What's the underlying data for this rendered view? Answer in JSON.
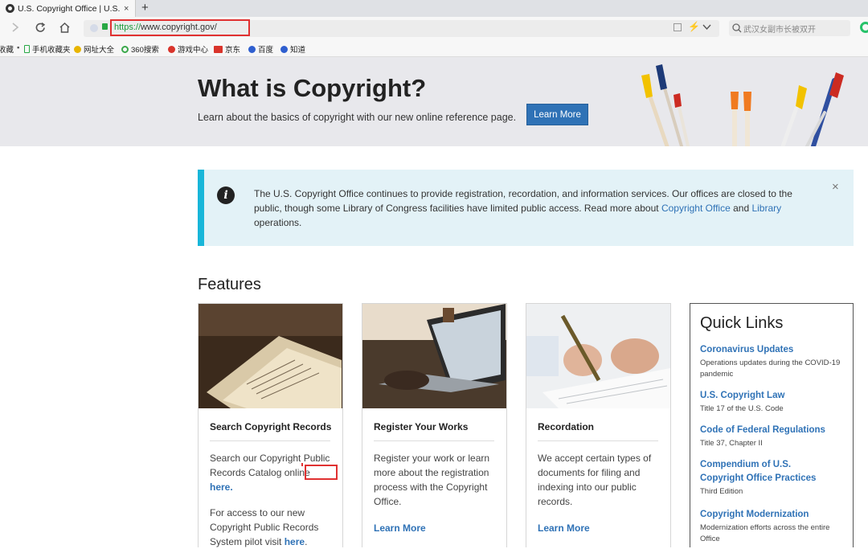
{
  "browser": {
    "tab_title": "U.S. Copyright Office | U.S. C",
    "tab_close": "×",
    "new_tab": "+",
    "url_scheme": "https://",
    "url_host": "www.copyright.gov/",
    "search_placeholder": "武汉女副市长被双开",
    "bookmarks": [
      "收藏",
      "手机收藏夹",
      "网址大全",
      "360搜索",
      "游戏中心",
      "京东",
      "百度",
      "知道"
    ]
  },
  "hero": {
    "title": "What is Copyright?",
    "subtitle": "Learn about the basics of copyright with our new online reference page.",
    "button": "Learn More"
  },
  "alert": {
    "text_before": "The U.S. Copyright Office continues to provide registration, recordation, and information services. Our offices are closed to the public, though some Library of Congress facilities have limited public access. Read more about ",
    "link1": "Copyright Office",
    "and": " and ",
    "link2": "Library",
    "text_after": " operations.",
    "close": "×",
    "icon": "i"
  },
  "features": {
    "heading": "Features",
    "cards": [
      {
        "title": "Search Copyright Records",
        "body1": "Search our Copyright Public Records Catalog online ",
        "body1_link": "here.",
        "body2": "For access to our new Copyright Public Records System pilot visit ",
        "body2_link": "here",
        "body2_end": "."
      },
      {
        "title": "Register Your Works",
        "body": "Register your work or learn more about the registration process with the Copyright Office.",
        "link": "Learn More"
      },
      {
        "title": "Recordation",
        "body": "We accept certain types of documents for filing and indexing into our public records.",
        "link": "Learn More"
      }
    ]
  },
  "quick_links": {
    "title": "Quick Links",
    "items": [
      {
        "label": "Coronavirus Updates",
        "desc": "Operations updates during the COVID-19 pandemic"
      },
      {
        "label": "U.S. Copyright Law",
        "desc": "Title 17 of the U.S. Code"
      },
      {
        "label": "Code of Federal Regulations",
        "desc": "Title 37, Chapter II"
      },
      {
        "label": "Compendium of U.S. Copyright Office Practices",
        "desc": "Third Edition"
      },
      {
        "label": "Copyright Modernization",
        "desc": "Modernization efforts across the entire Office"
      }
    ]
  }
}
